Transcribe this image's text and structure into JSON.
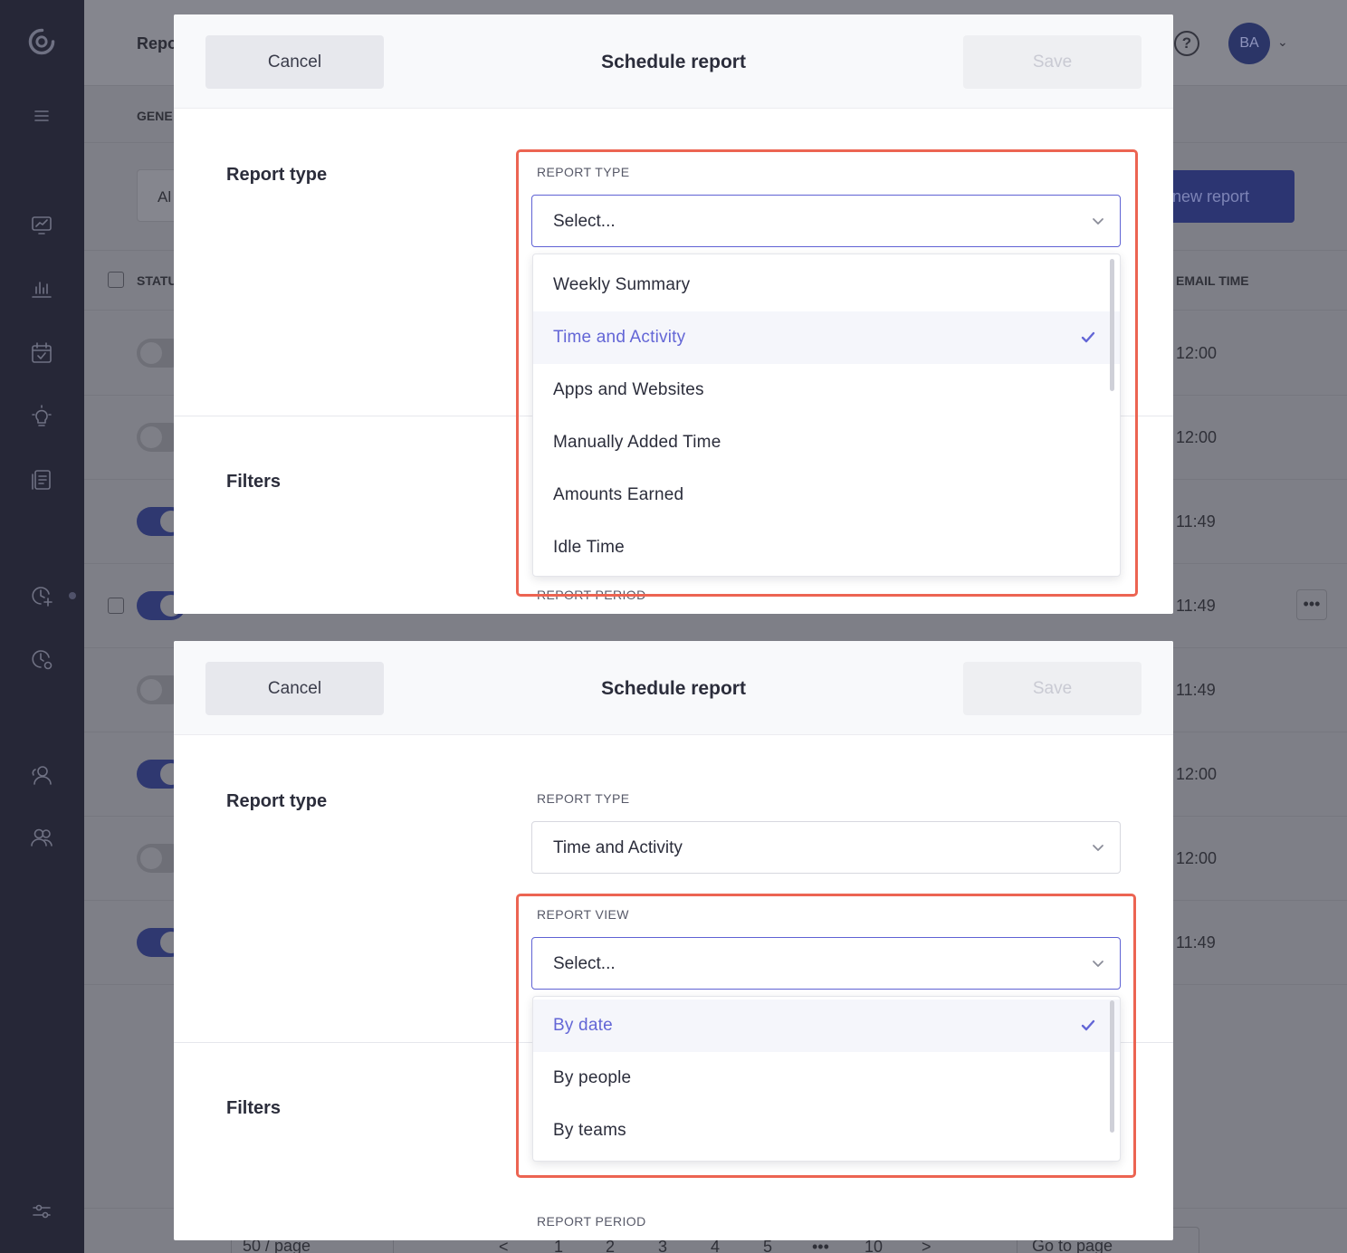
{
  "sidebar": {
    "icons": [
      "logo-icon",
      "menu-icon",
      "dashboard-icon",
      "reports-icon",
      "calendar-icon",
      "insights-icon",
      "projects-icon",
      "time-add-icon",
      "time-settings-icon",
      "person-icon",
      "people-icon",
      "settings-sliders-icon"
    ]
  },
  "background": {
    "page_title": "Repo",
    "tab": "GENE",
    "filter_select": "Al",
    "help_icon": "?",
    "avatar_initials": "BA",
    "new_report_button": "new report",
    "columns": {
      "status": "STATU",
      "email_time": "EMAIL TIME"
    },
    "rows": [
      {
        "toggle": "off",
        "time": "12:00"
      },
      {
        "toggle": "off",
        "time": "12:00"
      },
      {
        "toggle": "on",
        "time": "11:49"
      },
      {
        "toggle": "on",
        "time": "11:49"
      },
      {
        "toggle": "off",
        "time": "11:49"
      },
      {
        "toggle": "on",
        "time": "12:00"
      },
      {
        "toggle": "off",
        "time": "12:00"
      },
      {
        "toggle": "on",
        "time": "11:49"
      }
    ],
    "more_button": "•••",
    "pager": {
      "per_page": "50 / page",
      "prev": "<",
      "pages": [
        "1",
        "2",
        "3",
        "4",
        "5",
        "•••",
        "10"
      ],
      "next": ">",
      "goto": "Go to page"
    }
  },
  "modal_top": {
    "cancel_label": "Cancel",
    "title": "Schedule report",
    "save_label": "Save",
    "section_report_type": "Report type",
    "section_filters": "Filters",
    "report_type_label": "REPORT TYPE",
    "report_type_value": "Select...",
    "dropdown_items": [
      "Weekly Summary",
      "Time and Activity",
      "Apps and Websites",
      "Manually Added Time",
      "Amounts Earned",
      "Idle Time"
    ],
    "selected_item": "Time and Activity",
    "report_period_label": "REPORT PERIOD"
  },
  "modal_bottom": {
    "cancel_label": "Cancel",
    "title": "Schedule report",
    "save_label": "Save",
    "section_report_type": "Report type",
    "section_filters": "Filters",
    "report_type_label": "REPORT TYPE",
    "report_type_value": "Time and Activity",
    "report_view_label": "REPORT VIEW",
    "report_view_value": "Select...",
    "dropdown_items": [
      "By date",
      "By people",
      "By teams"
    ],
    "selected_item": "By date",
    "report_period_label": "REPORT PERIOD"
  },
  "colors": {
    "accent": "#6366d6",
    "highlight_border": "#ec6452",
    "sidebar": "#262737"
  }
}
